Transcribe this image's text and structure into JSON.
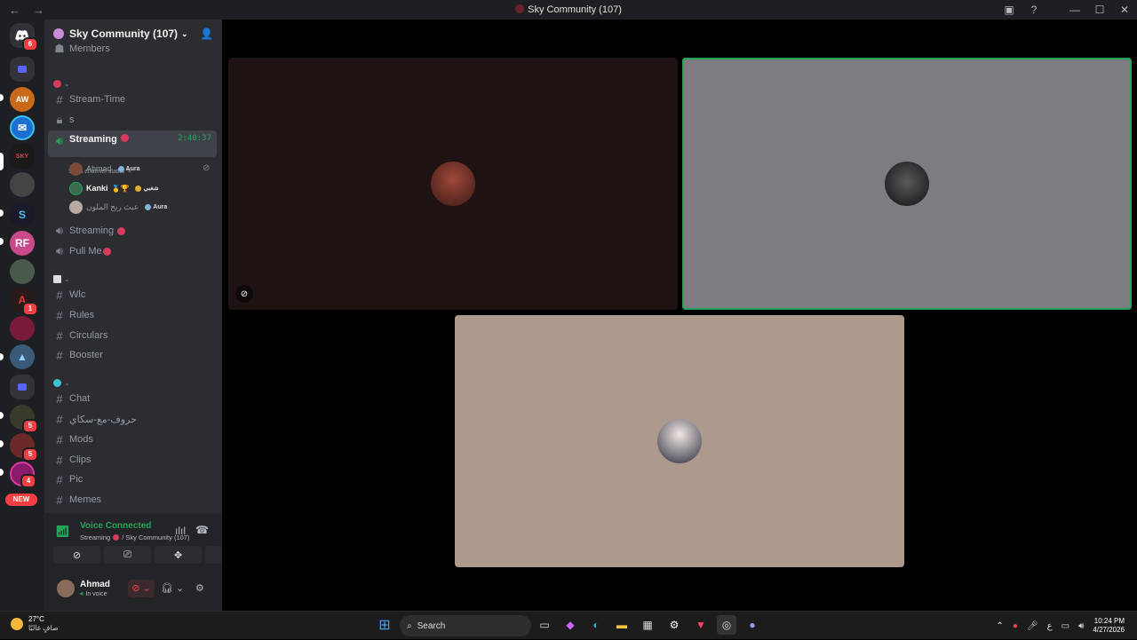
{
  "window": {
    "title": "Sky Community (107)",
    "nav_back": "←",
    "nav_fwd": "→",
    "inbox": "▣",
    "help": "?",
    "minimize": "—",
    "maximize": "☐",
    "close": "✕"
  },
  "guilds": {
    "home_badge": "6",
    "badges": [
      "1",
      "5",
      "5",
      "4"
    ],
    "new_label": "NEW"
  },
  "server": {
    "name": "Sky Community (107)",
    "caret": "⌄",
    "invite_icon": "👤"
  },
  "channels": {
    "members": "Members",
    "stream_time": "Stream-Time",
    "s": "s",
    "streaming_active": "Streaming",
    "streaming_time": "2:40:37",
    "set_status": "Set a channel status",
    "streaming2": "Streaming",
    "pull_me": "Pull Me",
    "wlc": "Wlc",
    "rules": "Rules",
    "circulars": "Circulars",
    "booster": "Booster",
    "chat": "Chat",
    "arabic": "حروف-مع-سكاي",
    "mods": "Mods",
    "clips": "Clips",
    "pic": "Pic",
    "memes": "Memes"
  },
  "voice_users": [
    {
      "name": "Ahmad",
      "tag": "Aura",
      "avatar_color": "#7a4a3a"
    },
    {
      "name": "Kanki",
      "tag": "شغبي",
      "avatar_color": "#3b6b4e"
    },
    {
      "name": "عبث ريح الملون",
      "tag": "Aura",
      "avatar_color": "#b7a8a0"
    }
  ],
  "voice_panel": {
    "status": "Voice Connected",
    "location_channel": "Streaming",
    "location_server": "/ Sky Community (107)",
    "btn_camera": "⊘",
    "btn_screen": "⎚",
    "btn_activity": "✥",
    "btn_soundboard": "✺"
  },
  "user": {
    "name": "Ahmad",
    "status": "In voice"
  },
  "tiles": [
    {
      "bg": "#1e1312",
      "avatar": "#6b2a20"
    },
    {
      "bg": "#7d7c82",
      "avatar": "#2b2b2e"
    },
    {
      "bg": "#ad9a8d",
      "avatar": "#c9c4c0"
    }
  ],
  "taskbar": {
    "temp": "27°C",
    "weather": "صافٍ غالبًا",
    "search": "Search",
    "lang": "ع",
    "time": "10:24 PM",
    "date": "4/27/2026"
  },
  "colors": {
    "accent_green": "#23a559",
    "live_red": "#d83a5d",
    "sidebar_bg": "#2b2d31"
  }
}
